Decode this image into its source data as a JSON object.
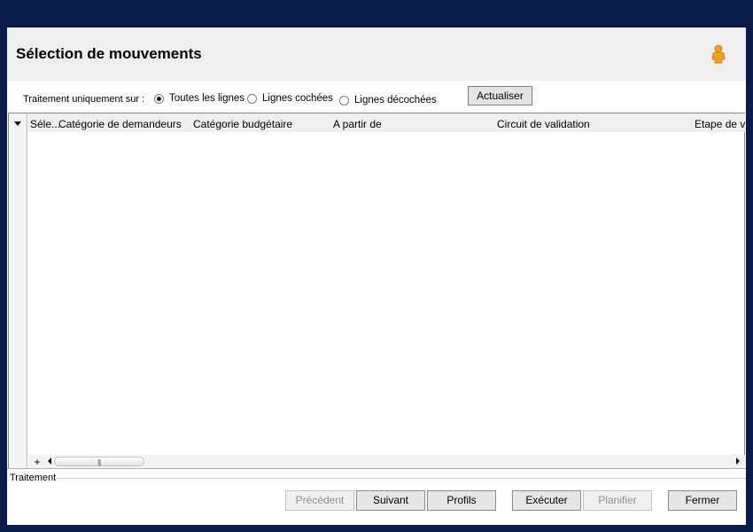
{
  "header": {
    "title": "Sélection de mouvements",
    "user_icon": "user-icon"
  },
  "filter": {
    "label": "Traitement uniquement sur :",
    "options": [
      {
        "label": "Toutes les lignes",
        "checked": true
      },
      {
        "label": "Lignes cochées",
        "checked": false
      },
      {
        "label": "Lignes décochées",
        "checked": false
      }
    ],
    "refresh_label": "Actualiser"
  },
  "grid": {
    "columns": [
      "Séle...",
      "Catégorie de demandeurs",
      "Catégorie budgétaire",
      "A partir de",
      "Circuit de validation",
      "Etape de v"
    ],
    "rows": [],
    "add_label": "+"
  },
  "status": {
    "label": "Traitement"
  },
  "buttons": {
    "previous": "Précédent",
    "next": "Suivant",
    "profiles": "Profils",
    "execute": "Exécuter",
    "schedule": "Planifier",
    "close": "Fermer"
  }
}
